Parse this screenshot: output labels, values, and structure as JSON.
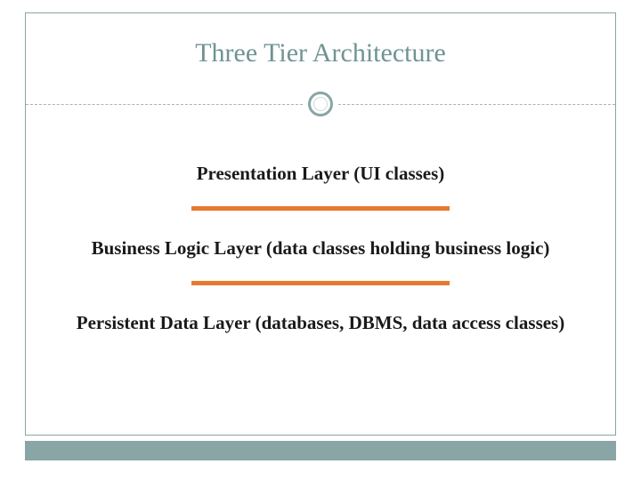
{
  "title": "Three Tier Architecture",
  "layers": {
    "presentation": "Presentation Layer (UI classes)",
    "business": "Business Logic Layer (data classes holding business logic)",
    "persistent": "Persistent Data Layer (databases, DBMS, data access classes)"
  },
  "colors": {
    "accent": "#8aa5a5",
    "rule": "#e67a2e"
  }
}
